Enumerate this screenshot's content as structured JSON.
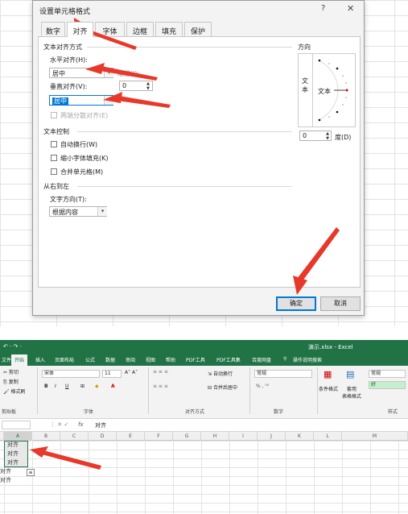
{
  "dialog": {
    "title": "设置单元格格式",
    "help": "?",
    "close": "✕",
    "tabs": [
      {
        "label": "数字"
      },
      {
        "label": "对齐"
      },
      {
        "label": "字体"
      },
      {
        "label": "边框"
      },
      {
        "label": "填充"
      },
      {
        "label": "保护"
      }
    ],
    "active_tab": "对齐",
    "text_alignment": {
      "section": "文本对齐方式",
      "horizontal_label": "水平对齐(H):",
      "horizontal_value": "居中",
      "indent_label": "缩进(I):",
      "indent_value": "0",
      "vertical_label": "垂直对齐(V):",
      "vertical_value": "居中",
      "distributed_label": "两端分散对齐(E)"
    },
    "text_control": {
      "section": "文本控制",
      "wrap": "自动换行(W)",
      "shrink": "缩小字体填充(K)",
      "merge": "合并单元格(M)"
    },
    "rtl": {
      "section": "从右到左",
      "direction_label": "文字方向(T):",
      "direction_value": "根据内容"
    },
    "orientation": {
      "section": "方向",
      "vertical_text": "文本",
      "rotated_text": "文本",
      "degrees_value": "0",
      "degrees_label": "度(D)"
    },
    "ok": "确定",
    "cancel": "取消"
  },
  "excel": {
    "window_title": "演示.xlsx - Excel",
    "qat": "↶ · ↷ ·",
    "ribbon_tabs": [
      "文件",
      "开始",
      "插入",
      "页面布局",
      "公式",
      "数据",
      "审阅",
      "视图",
      "帮助",
      "PDF工具",
      "PDF工具集",
      "百度网盘",
      "操作说明搜索"
    ],
    "active_ribbon_tab": "开始",
    "clipboard": {
      "cut": "剪切",
      "copy": "复制",
      "painter": "格式刷",
      "group": "剪贴板"
    },
    "font": {
      "name": "宋体",
      "size": "11",
      "bold": "B",
      "italic": "I",
      "underline": "U",
      "group": "字体"
    },
    "alignment": {
      "wrap": "自动换行",
      "merge": "合并后居中",
      "group": "对齐方式"
    },
    "number": {
      "format": "常规",
      "group": "数字"
    },
    "styles": {
      "conditional": "条件格式",
      "table": "套用\n表格格式",
      "normal": "常规",
      "good": "好",
      "group": "样式"
    },
    "formula_bar": {
      "fx": "fx",
      "content": "对齐"
    },
    "columns": [
      "A",
      "B",
      "C",
      "D",
      "E",
      "F",
      "G",
      "H",
      "I",
      "J",
      "K",
      "L",
      "M"
    ],
    "cells": [
      "对齐",
      "对齐",
      "对齐",
      "对齐",
      "对齐"
    ]
  },
  "colors": {
    "excel_green": "#217346",
    "arrow_red": "#e8382a",
    "selection_blue": "#0078d7"
  }
}
